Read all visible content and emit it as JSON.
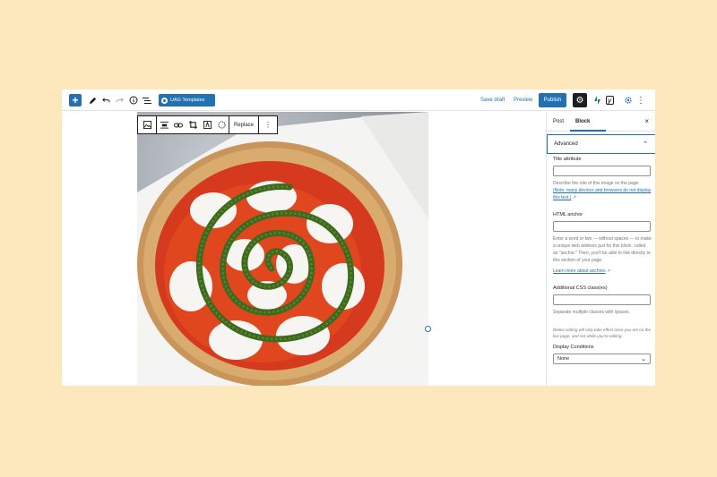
{
  "toolbar": {
    "uag_label": "UAG Templates",
    "save_draft": "Save draft",
    "preview": "Preview",
    "publish": "Publish",
    "add_icon": "+",
    "settings_icon": "⚙",
    "more_icon": "⋮",
    "yoast_icon": "y",
    "icons": [
      "add-icon",
      "pencil-icon",
      "undo-icon",
      "redo-icon",
      "info-icon",
      "list-view-icon",
      "jetpack-icon",
      "yoast-icon",
      "star-gear-icon",
      "more-vertical-icon"
    ]
  },
  "block_toolbar": {
    "replace": "Replace",
    "more_icon": "⋮"
  },
  "sidebar": {
    "tab_post": "Post",
    "tab_block": "Block",
    "close_icon": "×",
    "advanced_title": "Advanced",
    "advanced_chevron": "⌃",
    "title_attribute_label": "Title attribute",
    "title_attribute_help": "Describe the role of this image on the page.",
    "title_attribute_link": "(Note: many devices and browsers do not display this text.)",
    "html_anchor_label": "HTML anchor",
    "html_anchor_help": "Enter a word or two — without spaces — to make a unique web address just for this block, called an \"anchor.\" Then, you'll be able to link directly to this section of your page.",
    "html_anchor_link": "Learn more about anchors",
    "css_label": "Additional CSS class(es)",
    "css_help": "Separate multiple classes with spaces.",
    "note": "Below setting will only take effect once you are on the live page, and not while you're editing.",
    "display_conditions_label": "Display Conditions",
    "display_conditions_value": "None",
    "select_chevron": "⌄"
  }
}
